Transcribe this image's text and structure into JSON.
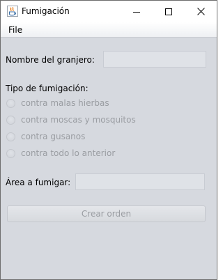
{
  "window": {
    "title": "Fumigación"
  },
  "menubar": {
    "file_label": "File"
  },
  "form": {
    "farmer_label": "Nombre del granjero:",
    "farmer_value": "",
    "fumigation_type_label": "Tipo de fumigación:",
    "options": [
      {
        "label": "contra malas hierbas",
        "selected": false
      },
      {
        "label": "contra moscas y mosquitos",
        "selected": false
      },
      {
        "label": "contra gusanos",
        "selected": false
      },
      {
        "label": "contra todo lo anterior",
        "selected": false
      }
    ],
    "area_label": "Área a fumigar:",
    "area_value": "",
    "submit_label": "Crear orden"
  },
  "colors": {
    "window_bg": "#d6d9df",
    "disabled_text": "#9a9da2",
    "field_bg": "#dfe2e7"
  }
}
